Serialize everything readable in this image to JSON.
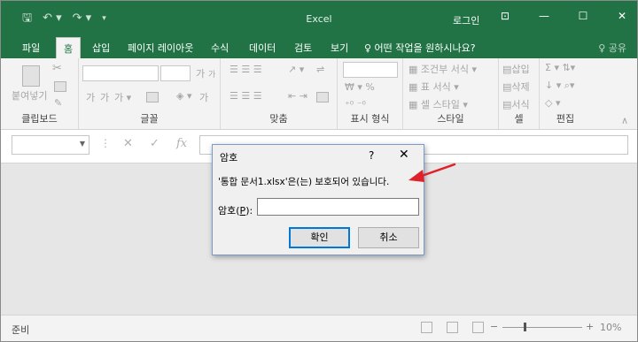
{
  "window": {
    "title": "Excel",
    "login": "로그인",
    "qat_icons": [
      "save-icon",
      "undo-icon",
      "redo-icon",
      "customize-icon"
    ],
    "controls": [
      "ribbon-options-icon",
      "minimize-icon",
      "restore-icon",
      "close-icon"
    ]
  },
  "tabs": [
    {
      "label": "파일"
    },
    {
      "label": "홈"
    },
    {
      "label": "삽입"
    },
    {
      "label": "페이지 레이아웃"
    },
    {
      "label": "수식"
    },
    {
      "label": "데이터"
    },
    {
      "label": "검토"
    },
    {
      "label": "보기"
    }
  ],
  "tell_me": "♀ 어떤 작업을 원하시나요?",
  "share": "♀ 공유",
  "ribbon": {
    "groups": [
      {
        "label": "클립보드"
      },
      {
        "label": "글꼴"
      },
      {
        "label": "맞춤"
      },
      {
        "label": "표시 형식"
      },
      {
        "label": "스타일"
      },
      {
        "label": "셀"
      },
      {
        "label": "편집"
      }
    ],
    "paste_label": "붙여넣기",
    "style_items": [
      "조건부 서식",
      "표 서식",
      "셀 스타일"
    ],
    "cell_items": [
      "삽입",
      "삭제",
      "서식"
    ],
    "font_size_big": "가",
    "font_size_small": "가",
    "font_color": "가"
  },
  "formula_bar": {
    "fx": "fx",
    "cancel": "✕",
    "enter": "✓"
  },
  "status": {
    "ready": "준비",
    "zoom_percent": "10%",
    "zoom_minus": "−",
    "zoom_plus": "+"
  },
  "dialog": {
    "title": "암호",
    "help": "?",
    "close": "✕",
    "message": "'통합 문서1.xlsx'은(는) 보호되어 있습니다.",
    "password_label_prefix": "암호(",
    "password_label_key": "P",
    "password_label_suffix": "):",
    "password_value": "",
    "ok": "확인",
    "cancel": "취소"
  },
  "colors": {
    "excel_green": "#217346",
    "annotation_arrow": "#e0202a"
  }
}
